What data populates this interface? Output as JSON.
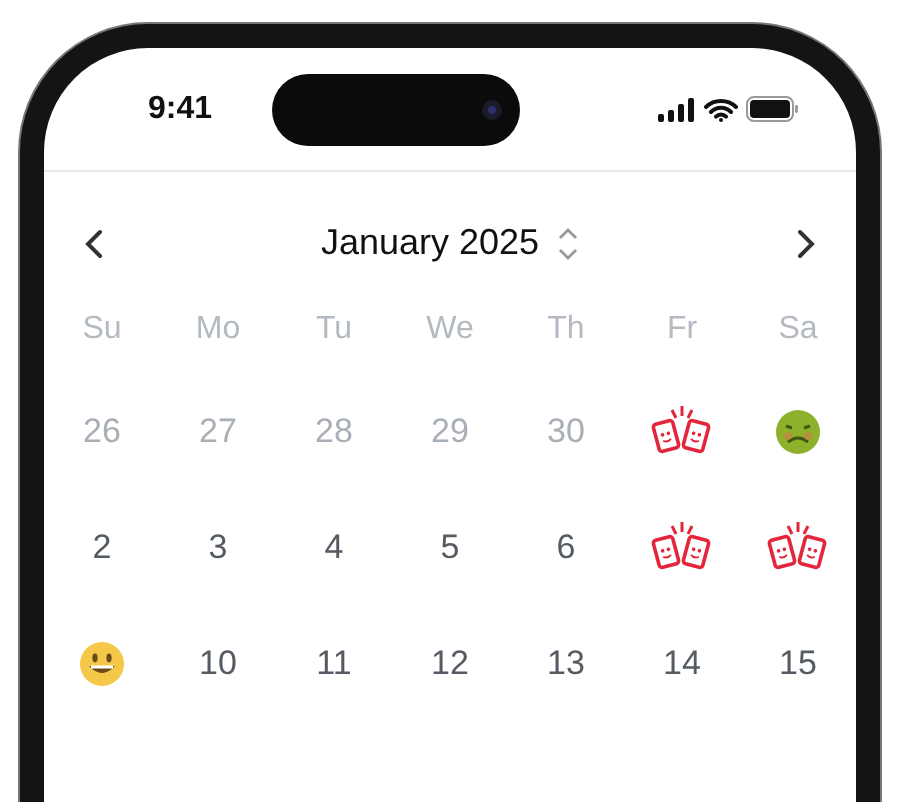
{
  "status_bar": {
    "time": "9:41"
  },
  "calendar": {
    "title": "January 2025",
    "weekdays": [
      "Su",
      "Mo",
      "Tu",
      "We",
      "Th",
      "Fr",
      "Sa"
    ],
    "weeks": [
      [
        {
          "kind": "date",
          "text": "26",
          "muted": true
        },
        {
          "kind": "date",
          "text": "27",
          "muted": true
        },
        {
          "kind": "date",
          "text": "28",
          "muted": true
        },
        {
          "kind": "date",
          "text": "29",
          "muted": true
        },
        {
          "kind": "date",
          "text": "30",
          "muted": true
        },
        {
          "kind": "cheers"
        },
        {
          "kind": "sick"
        }
      ],
      [
        {
          "kind": "date",
          "text": "2",
          "muted": false
        },
        {
          "kind": "date",
          "text": "3",
          "muted": false
        },
        {
          "kind": "date",
          "text": "4",
          "muted": false
        },
        {
          "kind": "date",
          "text": "5",
          "muted": false
        },
        {
          "kind": "date",
          "text": "6",
          "muted": false
        },
        {
          "kind": "cheers"
        },
        {
          "kind": "cheers"
        }
      ],
      [
        {
          "kind": "smile"
        },
        {
          "kind": "date",
          "text": "10",
          "muted": false
        },
        {
          "kind": "date",
          "text": "11",
          "muted": false
        },
        {
          "kind": "date",
          "text": "12",
          "muted": false
        },
        {
          "kind": "date",
          "text": "13",
          "muted": false
        },
        {
          "kind": "date",
          "text": "14",
          "muted": false
        },
        {
          "kind": "date",
          "text": "15",
          "muted": false
        }
      ]
    ]
  }
}
